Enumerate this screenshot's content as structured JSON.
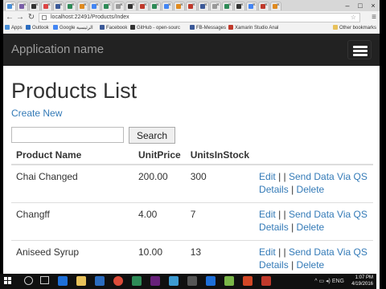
{
  "browser": {
    "url": "localhost:22491/Products/Index",
    "bookmarks": [
      {
        "label": "Apps",
        "color": "#4a90d9"
      },
      {
        "label": "Outlook",
        "color": "#2b6cbf"
      },
      {
        "label": "Google الرئيسية",
        "color": "#4285f4"
      },
      {
        "label": "Facebook",
        "color": "#3b5998"
      },
      {
        "label": "GitHub - open-sourc",
        "color": "#333333"
      },
      {
        "label": "FB-Messages",
        "color": "#3b5998"
      },
      {
        "label": "Xamarin Studio Anal",
        "color": "#c0392b"
      }
    ],
    "other_bookmarks": "Other bookmarks"
  },
  "app": {
    "brand": "Application name"
  },
  "page": {
    "title": "Products List",
    "create_new": "Create New",
    "search_button": "Search",
    "search_value": ""
  },
  "table": {
    "headers": [
      "Product Name",
      "UnitPrice",
      "UnitsInStock",
      ""
    ],
    "rows": [
      {
        "name": "Chai Changed",
        "price": "200.00",
        "stock": "300"
      },
      {
        "name": "Changff",
        "price": "4.00",
        "stock": "7"
      },
      {
        "name": "Aniseed Syrup",
        "price": "10.00",
        "stock": "13"
      }
    ],
    "actions": {
      "edit": "Edit",
      "send": "Send Data Via QS",
      "details": "Details",
      "delete": "Delete",
      "pipe": "|"
    }
  },
  "taskbar": {
    "time": "1:07 PM",
    "date": "4/19/2016",
    "lang": "ENG"
  },
  "colors": {
    "link": "#337ab7",
    "navbar": "#222222"
  }
}
